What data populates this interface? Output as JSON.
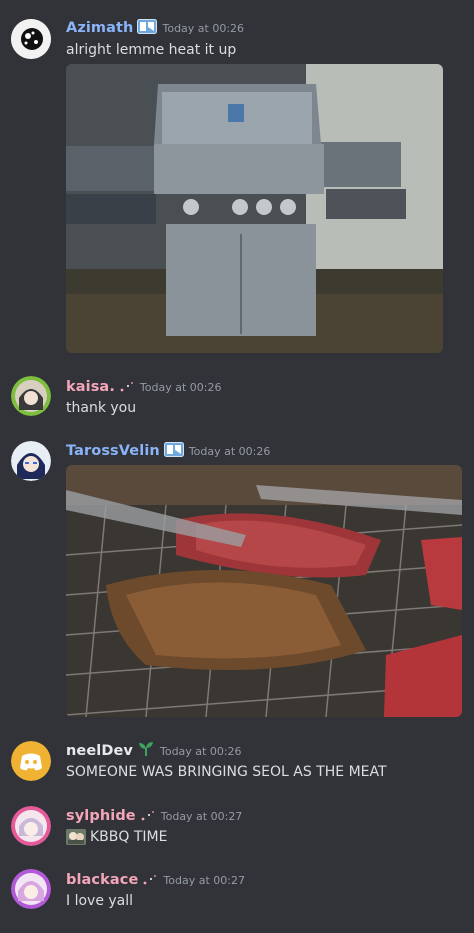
{
  "messages": [
    {
      "username": "Azimath",
      "username_color": "#8ab4f8",
      "badge_icon": "shield-tag-icon",
      "timestamp": "Today at 00:26",
      "text": "alright lemme heat it up",
      "attachment_icon": "bbq-grill-photo"
    },
    {
      "username": "kaisa.",
      "username_color": "#f4a6b8",
      "badge_icon": "sparkle-tag-icon",
      "timestamp": "Today at 00:26",
      "text": "thank you"
    },
    {
      "username": "TarossVelin",
      "username_color": "#8ab4f8",
      "badge_icon": "shield-tag-icon",
      "timestamp": "Today at 00:26",
      "attachment_icon": "grilled-meat-photo"
    },
    {
      "username": "neelDev",
      "username_color": "#e8e9eb",
      "badge_icon": "sprout-icon",
      "timestamp": "Today at 00:26",
      "text": "SOMEONE WAS BRINGING SEOL AS THE MEAT"
    },
    {
      "username": "sylphide",
      "username_color": "#f4a6b8",
      "badge_icon": "sparkle-tag-icon",
      "timestamp": "Today at 00:27",
      "emoji_icon": "anime-emoji-icon",
      "text": "KBBQ TIME"
    },
    {
      "username": "blackace",
      "username_color": "#f4a6b8",
      "badge_icon": "sparkle-tag-icon",
      "timestamp": "Today at 00:27",
      "text": "I love yall"
    }
  ],
  "colors": {
    "background": "#313338",
    "text": "#dbdee1",
    "timestamp": "#949ba4",
    "discord_blurple_orange": "#f0b232"
  }
}
